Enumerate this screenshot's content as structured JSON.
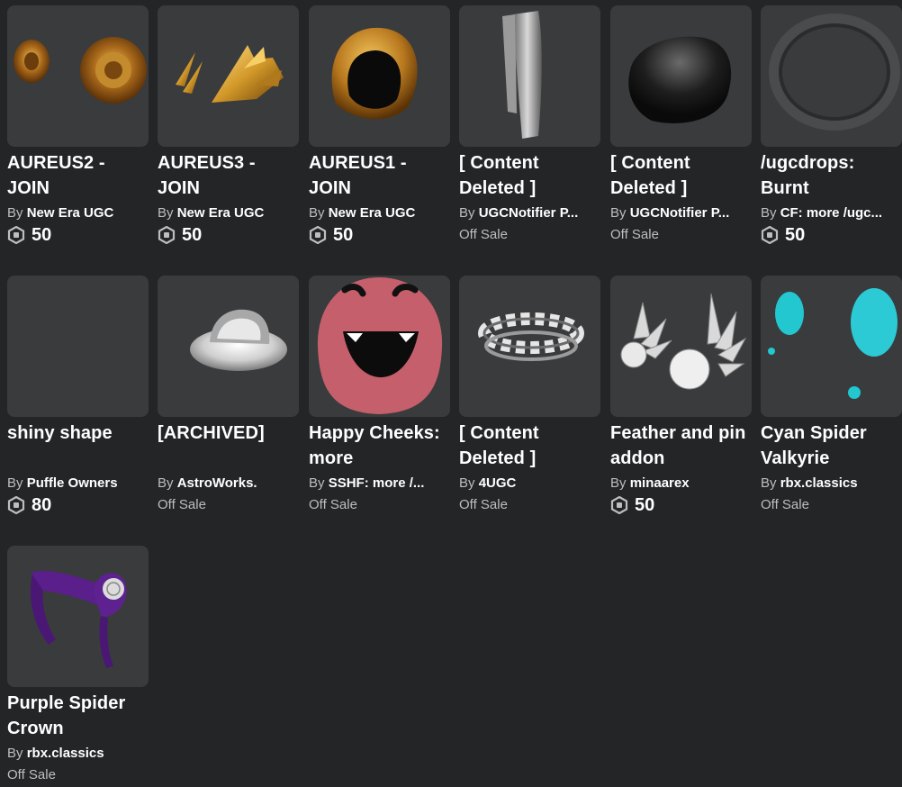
{
  "items": [
    {
      "name": "AUREUS2 - JOIN",
      "by": "By",
      "creator": "New Era UGC",
      "price": "50",
      "status": ""
    },
    {
      "name": "AUREUS3 - JOIN",
      "by": "By",
      "creator": "New Era UGC",
      "price": "50",
      "status": ""
    },
    {
      "name": "AUREUS1 - JOIN",
      "by": "By",
      "creator": "New Era UGC",
      "price": "50",
      "status": ""
    },
    {
      "name": "[ Content Deleted ]",
      "by": "By",
      "creator": "UGCNotifier P...",
      "price": "",
      "status": "Off Sale"
    },
    {
      "name": "[ Content Deleted ]",
      "by": "By",
      "creator": "UGCNotifier P...",
      "price": "",
      "status": "Off Sale"
    },
    {
      "name": "/ugcdrops: Burnt",
      "by": "By",
      "creator": "CF: more /ugc...",
      "price": "50",
      "status": ""
    },
    {
      "name": "shiny shape",
      "by": "By",
      "creator": "Puffle Owners",
      "price": "80",
      "status": ""
    },
    {
      "name": "[ARCHIVED]",
      "by": "By",
      "creator": "AstroWorks.",
      "price": "",
      "status": "Off Sale"
    },
    {
      "name": "Happy Cheeks: more",
      "by": "By",
      "creator": "SSHF: more /...",
      "price": "",
      "status": "Off Sale"
    },
    {
      "name": "[ Content Deleted ]",
      "by": "By",
      "creator": "4UGC",
      "price": "",
      "status": "Off Sale"
    },
    {
      "name": "Feather and pin addon",
      "by": "By",
      "creator": "minaarex",
      "price": "50",
      "status": ""
    },
    {
      "name": "Cyan Spider Valkyrie",
      "by": "By",
      "creator": "rbx.classics",
      "price": "",
      "status": "Off Sale"
    },
    {
      "name": "Purple Spider Crown",
      "by": "By",
      "creator": "rbx.classics",
      "price": "",
      "status": "Off Sale"
    }
  ],
  "icons": {
    "currency": "robux-icon",
    "thumbnails": [
      "gold-earrings",
      "gold-spikes",
      "gold-hood",
      "gray-scarf",
      "black-hat",
      "gray-ring",
      "empty",
      "white-bucket-hat",
      "pink-hood",
      "spiked-band",
      "white-feathers",
      "cyan-spots",
      "purple-crown"
    ]
  },
  "colors": {
    "background": "#232527",
    "card_thumb": "#393b3d",
    "secondary_text": "#bdbebe",
    "primary_text": "#ffffff"
  }
}
